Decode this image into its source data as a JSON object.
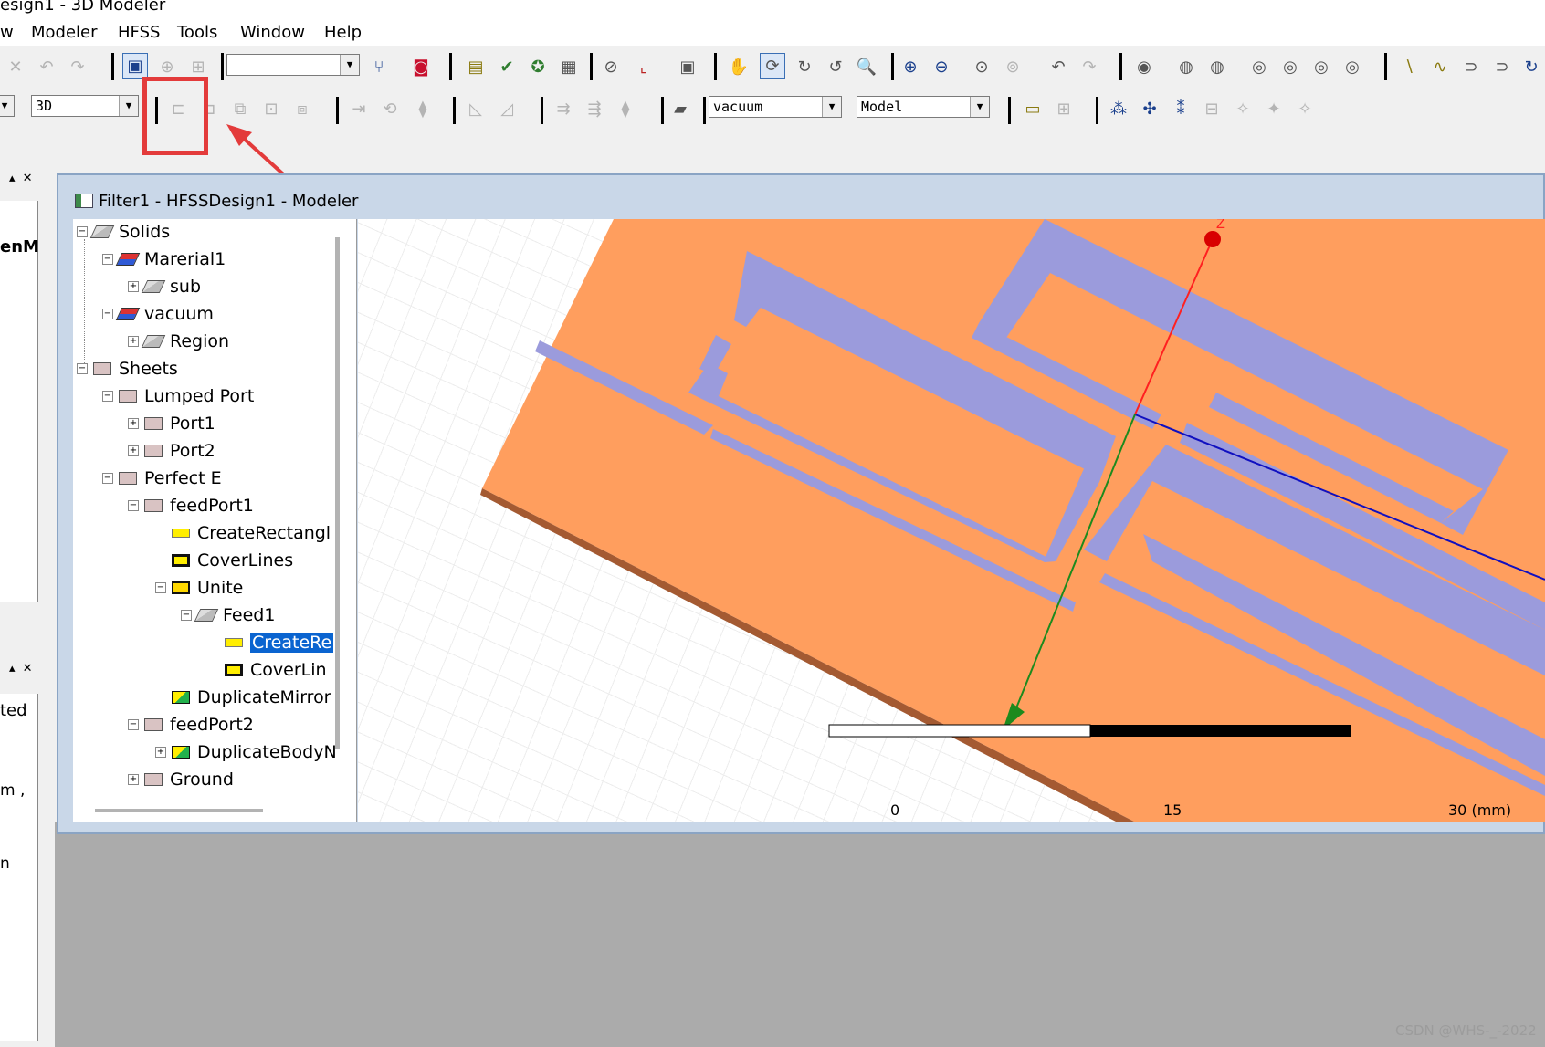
{
  "window": {
    "title": "esign1 - 3D Modeler"
  },
  "menu": [
    "w",
    "Modeler",
    "HFSS",
    "Tools",
    "Window",
    "Help"
  ],
  "toolbar": {
    "view_mode": "3D",
    "material": "vacuum",
    "model_type": "Model",
    "first_combo": ""
  },
  "dock": {
    "partial_label_1": "enM",
    "partial_label_2": "ted",
    "partial_label_3": "m ,",
    "partial_label_4": "n"
  },
  "document": {
    "title": "Filter1 - HFSSDesign1 - Modeler"
  },
  "tree": [
    {
      "label": "Solids"
    },
    {
      "label": "Marerial1"
    },
    {
      "label": "sub"
    },
    {
      "label": "vacuum"
    },
    {
      "label": "Region"
    },
    {
      "label": "Sheets"
    },
    {
      "label": "Lumped Port"
    },
    {
      "label": "Port1"
    },
    {
      "label": "Port2"
    },
    {
      "label": "Perfect E"
    },
    {
      "label": "feedPort1"
    },
    {
      "label": "CreateRectangl"
    },
    {
      "label": "CoverLines"
    },
    {
      "label": "Unite"
    },
    {
      "label": "Feed1"
    },
    {
      "label": "CreateRe"
    },
    {
      "label": "CoverLin"
    },
    {
      "label": "DuplicateMirror"
    },
    {
      "label": "feedPort2"
    },
    {
      "label": "DuplicateBodyN"
    },
    {
      "label": "Ground"
    }
  ],
  "view": {
    "axis_label": "Z",
    "scale_labels": [
      "0",
      "15",
      "30 (mm)"
    ],
    "substrate_color": "#ff9e5e",
    "strip_color": "#9b9bdc"
  },
  "watermark": "CSDN @WHS-_-2022"
}
